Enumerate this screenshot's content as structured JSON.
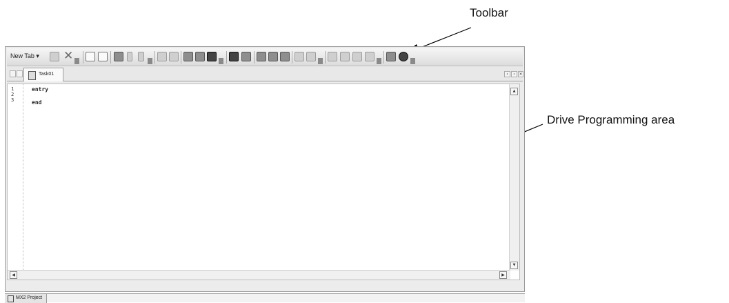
{
  "annotations": {
    "toolbar_label": "Toolbar",
    "drive_area_label": "Drive Programming area"
  },
  "toolbar": {
    "new_tab_label": "New Tab",
    "icons": [
      "window-icon",
      "close-icon",
      "copy-icon",
      "paste-page-icon",
      "compile-icon",
      "run-icon",
      "stop-icon",
      "undo-icon",
      "redo-icon",
      "cut-icon",
      "copy-icon",
      "paste-icon",
      "find-icon",
      "replace-icon",
      "indent-icon",
      "outdent-icon",
      "align-icon",
      "comment-icon",
      "uncomment-icon",
      "breakpoint-icon",
      "step-icon",
      "step-over-icon",
      "step-out-icon",
      "book-icon",
      "help-icon"
    ]
  },
  "tabs": [
    {
      "label": "Task01",
      "icon": "document-icon"
    }
  ],
  "editor": {
    "line_numbers": [
      "1",
      "2",
      "3"
    ],
    "lines": [
      "entry",
      "",
      "end"
    ]
  },
  "bottom_tabs": [
    {
      "label": "MX2 Project",
      "icon": "project-icon"
    }
  ],
  "colors": {
    "toolbar_bg": "#dcdcdc",
    "editor_bg": "#ffffff",
    "border": "#9a9a9a"
  }
}
